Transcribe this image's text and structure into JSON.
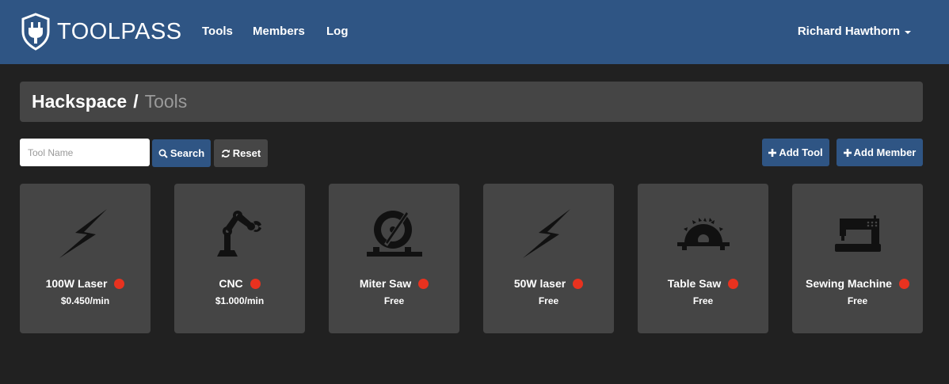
{
  "app": {
    "brand": "TOOLPASS",
    "brand_icon": "shield-plug-icon"
  },
  "nav": {
    "items": [
      {
        "label": "Tools"
      },
      {
        "label": "Members"
      },
      {
        "label": "Log"
      }
    ]
  },
  "user": {
    "name": "Richard Hawthorn"
  },
  "breadcrumb": {
    "root": "Hackspace",
    "separator": "/",
    "current": "Tools"
  },
  "toolbar": {
    "search_placeholder": "Tool Name",
    "search_label": "Search",
    "reset_label": "Reset",
    "add_tool_label": "Add Tool",
    "add_member_label": "Add Member"
  },
  "colors": {
    "navbar": "#2f5584",
    "background": "#212121",
    "card": "#454545",
    "status_red": "#e8321f"
  },
  "tools": [
    {
      "name": "100W Laser",
      "price": "$0.450/min",
      "icon": "lightning-bolt-icon",
      "status_color": "#e8321f"
    },
    {
      "name": "CNC",
      "price": "$1.000/min",
      "icon": "robotic-arm-icon",
      "status_color": "#e8321f"
    },
    {
      "name": "Miter Saw",
      "price": "Free",
      "icon": "miter-saw-icon",
      "status_color": "#e8321f"
    },
    {
      "name": "50W laser",
      "price": "Free",
      "icon": "lightning-bolt-icon",
      "status_color": "#e8321f"
    },
    {
      "name": "Table Saw",
      "price": "Free",
      "icon": "table-saw-icon",
      "status_color": "#e8321f"
    },
    {
      "name": "Sewing Machine",
      "price": "Free",
      "icon": "sewing-machine-icon",
      "status_color": "#e8321f"
    }
  ]
}
